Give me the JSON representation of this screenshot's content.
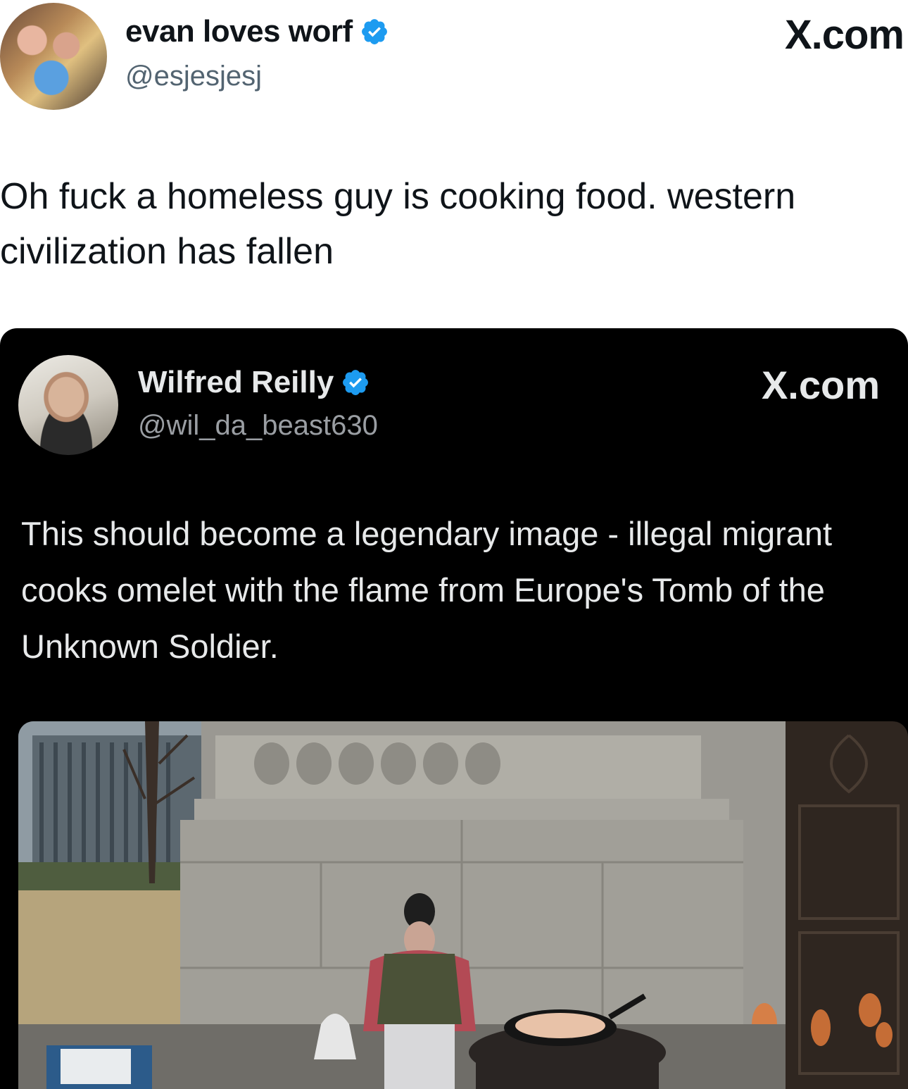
{
  "outer_tweet": {
    "display_name": "evan loves worf",
    "handle": "@esjesjesj",
    "site": "X.com",
    "text": "Oh fuck a homeless guy is cooking food. western civilization has fallen"
  },
  "quoted_tweet": {
    "display_name": "Wilfred Reilly",
    "handle": "@wil_da_beast630",
    "site": "X.com",
    "text": "This should become a legendary image - illegal migrant cooks omelet with the flame from Europe's Tomb of the Unknown Soldier."
  },
  "colors": {
    "verified_blue": "#1d9bf0",
    "text_dark": "#0f1419",
    "handle_gray": "#536471",
    "card_bg": "#000000",
    "card_text": "#e7e9ea"
  },
  "icons": {
    "verified": "verified-badge-icon"
  }
}
